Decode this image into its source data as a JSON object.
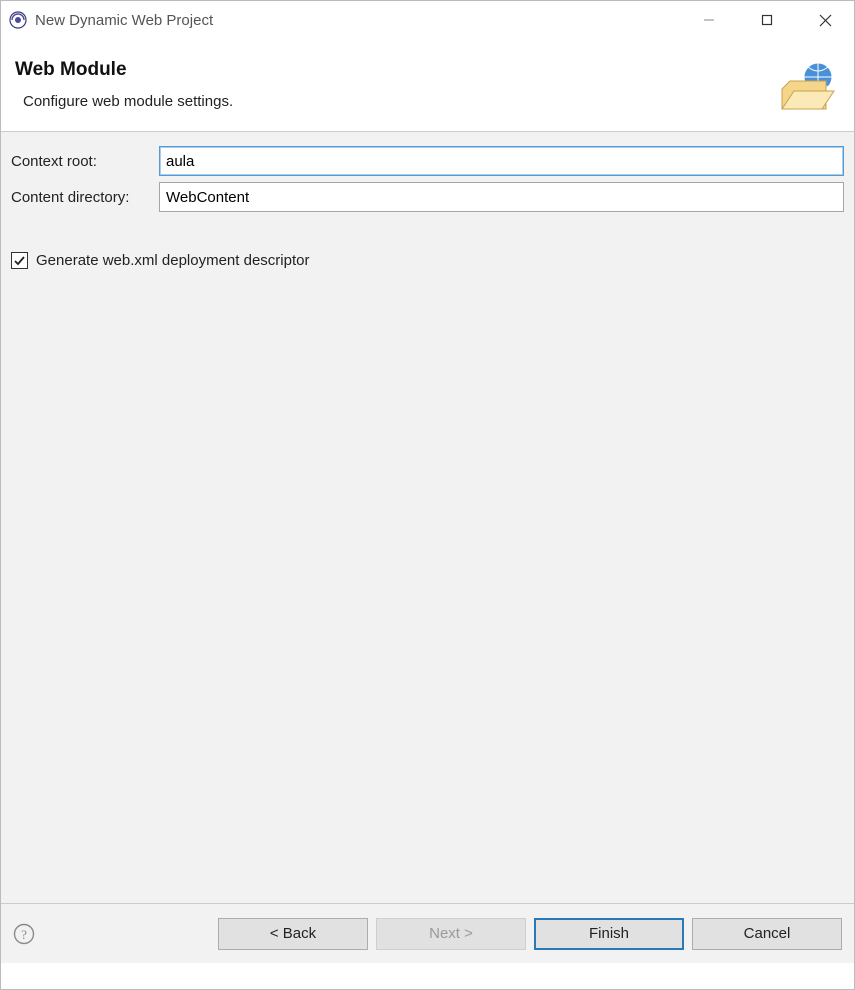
{
  "window": {
    "title": "New Dynamic Web Project"
  },
  "header": {
    "title": "Web Module",
    "subtitle": "Configure web module settings."
  },
  "form": {
    "context_root_label": "Context root:",
    "context_root_value": "aula",
    "content_dir_label": "Content directory:",
    "content_dir_value": "WebContent"
  },
  "checkbox": {
    "generate_webxml_label": "Generate web.xml deployment descriptor",
    "generate_webxml_checked": true
  },
  "buttons": {
    "back": "< Back",
    "next": "Next >",
    "finish": "Finish",
    "cancel": "Cancel"
  }
}
